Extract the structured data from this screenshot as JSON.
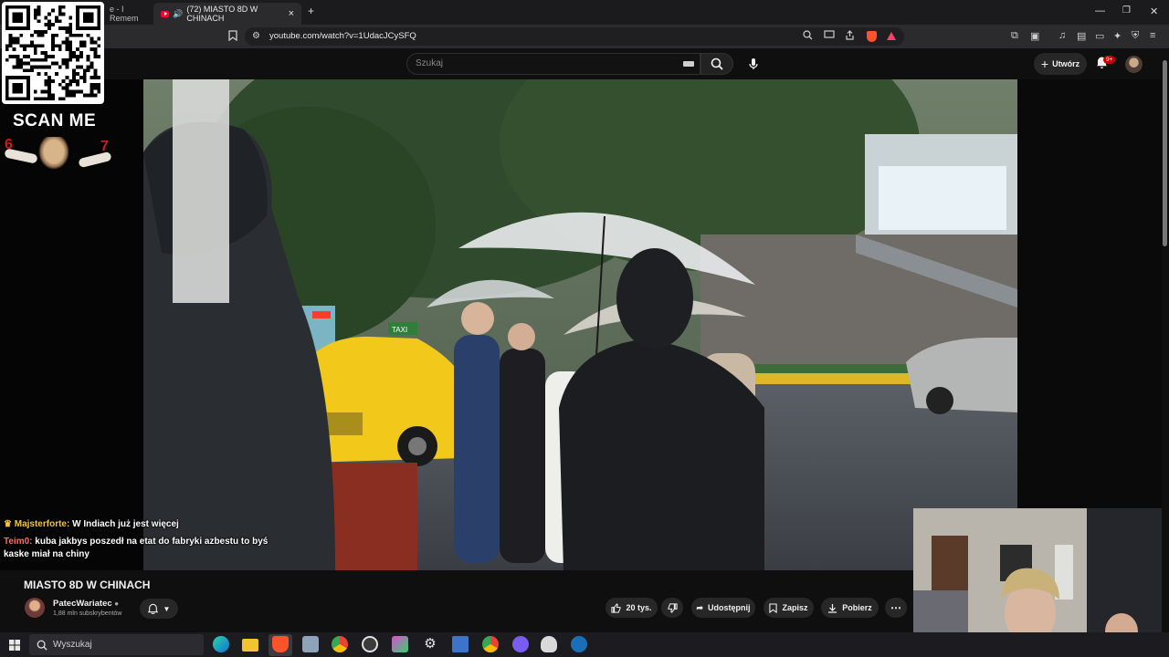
{
  "browser": {
    "tabs": [
      {
        "label": "e - I Remem"
      },
      {
        "label": "(72) MIASTO 8D W CHINACH",
        "close": "×"
      }
    ],
    "new_tab": "+",
    "url": "youtube.com/watch?v=1UdacJCySFQ"
  },
  "youtube": {
    "search_placeholder": "Szukaj",
    "create_label": "Utwórz",
    "notifications_badge": "9+"
  },
  "overlay": {
    "qr_caption": "SCAN ME",
    "mark_left": "6",
    "mark_right": "7",
    "chat": [
      {
        "author": "Majsterforte:",
        "message": "W Indiach już jest więcej"
      },
      {
        "author": "Teim0:",
        "message": "kuba jakbys poszedł na etat do fabryki azbestu to byś"
      },
      {
        "author": "",
        "message": "kaske miał na chiny"
      }
    ]
  },
  "video": {
    "title": "MIASTO 8D W CHINACH",
    "channel_name": "PatecWariatec",
    "subscribers": "1,88 mln subskrybentów",
    "likes": "20 tys.",
    "share_label": "Udostępnij",
    "save_label": "Zapisz",
    "download_label": "Pobierz",
    "more_label": "⋯",
    "scene_taxi_sign": "TAXI"
  },
  "taskbar": {
    "search_placeholder": "Wyszukaj"
  },
  "colors": {
    "yt_red": "#ff0033",
    "brave_orange": "#fb542b",
    "chat_gold": "#f4c542",
    "chat_red": "#ff6a6a",
    "taxi_yellow": "#f2c81a"
  }
}
